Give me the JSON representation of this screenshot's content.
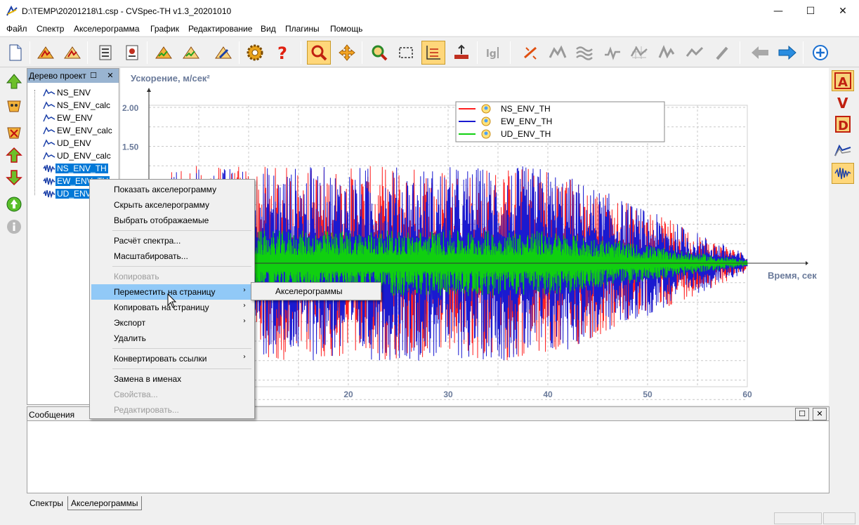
{
  "titlebar": {
    "title": "D:\\TEMP\\20201218\\1.csp - CVSpec-TH  v1.3_20201010",
    "minimize": "—",
    "maximize": "☐",
    "close": "✕"
  },
  "menubar": [
    "Файл",
    "Спектр",
    "Акселерограмма",
    "График",
    "Редактирование",
    "Вид",
    "Плагины",
    "Помощь"
  ],
  "tree": {
    "header": "Дерево проекта",
    "items": [
      {
        "label": "NS_ENV",
        "selected": false,
        "icon": "spectrum-icon"
      },
      {
        "label": "NS_ENV_calc",
        "selected": false,
        "icon": "spectrum-icon"
      },
      {
        "label": "EW_ENV",
        "selected": false,
        "icon": "spectrum-icon"
      },
      {
        "label": "EW_ENV_calc",
        "selected": false,
        "icon": "spectrum-icon"
      },
      {
        "label": "UD_ENV",
        "selected": false,
        "icon": "spectrum-icon"
      },
      {
        "label": "UD_ENV_calc",
        "selected": false,
        "icon": "spectrum-icon"
      },
      {
        "label": "NS_ENV_TH",
        "selected": true,
        "icon": "accelerogram-icon"
      },
      {
        "label": "EW_ENV_TH",
        "selected": true,
        "icon": "accelerogram-icon"
      },
      {
        "label": "UD_ENV_TH",
        "selected": true,
        "icon": "accelerogram-icon"
      }
    ]
  },
  "chart_data": {
    "type": "line",
    "ylabel": "Ускорение, м/сек²",
    "xlabel": "Время, сек",
    "x_ticks": [
      "20",
      "30",
      "40",
      "50",
      "60"
    ],
    "y_ticks": [
      "2.00",
      "1.50"
    ],
    "xlim": [
      0,
      60
    ],
    "ylim": [
      -2.0,
      2.0
    ],
    "grid": true,
    "legend_position": "top-center",
    "series": [
      {
        "name": "NS_ENV_TH",
        "color": "#ff2020"
      },
      {
        "name": "EW_ENV_TH",
        "color": "#1a1ad0"
      },
      {
        "name": "UD_ENV_TH",
        "color": "#10d010"
      }
    ]
  },
  "context_menu": {
    "items": [
      {
        "label": "Показать акселерограмму",
        "disabled": false
      },
      {
        "label": "Скрыть акселерограмму",
        "disabled": false
      },
      {
        "label": "Выбрать отображаемые",
        "disabled": false
      },
      {
        "label": "Расчёт спектра...",
        "disabled": false
      },
      {
        "label": "Масштабировать...",
        "disabled": false
      },
      {
        "label": "Копировать",
        "disabled": true
      },
      {
        "label": "Переместить на страницу",
        "disabled": false,
        "submenu": true,
        "highlighted": true
      },
      {
        "label": "Копировать на страницу",
        "disabled": false,
        "submenu": true
      },
      {
        "label": "Экспорт",
        "disabled": false,
        "submenu": true
      },
      {
        "label": "Удалить",
        "disabled": false
      },
      {
        "label": "Конвертировать ссылки",
        "disabled": false,
        "submenu": true
      },
      {
        "label": "Замена в именах",
        "disabled": false
      },
      {
        "label": "Свойства...",
        "disabled": true
      },
      {
        "label": "Редактировать...",
        "disabled": true
      }
    ],
    "submenu_items": [
      "Акселерограммы"
    ]
  },
  "messages": {
    "header": "Сообщения"
  },
  "bottom_tabs": [
    {
      "label": "Спектры",
      "active": false
    },
    {
      "label": "Акселерограммы",
      "active": true
    }
  ],
  "colors": {
    "selection": "#0078d7",
    "menu_highlight": "#91c9f7",
    "panel_header": "#99b4d1",
    "toolbar_active": "#ffd77a"
  }
}
